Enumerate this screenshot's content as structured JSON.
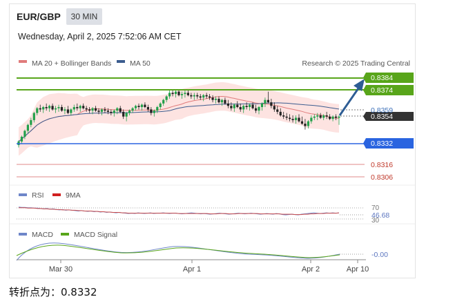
{
  "header": {
    "pair": "EUR/GBP",
    "timeframe": "30 MIN",
    "datetime": "Wednesday, April 2, 2025 7:52:06 AM CET"
  },
  "legend": {
    "ma20": "MA 20 + Bollinger Bands",
    "ma50": "MA 50",
    "research": "Research © 2025 Trading Central",
    "rsi": "RSI",
    "rsi_ma": "9MA",
    "macd": "MACD",
    "macd_signal": "MACD Signal"
  },
  "colors": {
    "resistance": "#58a51a",
    "pivot": "#2a64e0",
    "support": "#e08a8a",
    "support_text": "#c0392b",
    "current_box": "#333333",
    "ma20": "#e07b7b",
    "ma50": "#3b5c8f",
    "band": "#fde3e1",
    "candle_up": "#22a04a",
    "candle_down": "#222222",
    "arrow": "#2e5d94",
    "rsi": "#6e86c9",
    "rsi_ma": "#c94a4a",
    "macd": "#6e86c9",
    "macd_signal": "#58a51a"
  },
  "levels": {
    "resistance_2": "0.8384",
    "resistance_1": "0.8374",
    "ma50_label": "0.8359",
    "current": "0.8354",
    "pivot": "0.8332",
    "support_1": "0.8316",
    "support_2": "0.8306"
  },
  "rsi_panel": {
    "level_70": "70",
    "value": "46.68",
    "level_30": "30"
  },
  "macd_panel": {
    "value": "-0.00"
  },
  "footer": {
    "pivot_text": "转折点为：0.8332"
  },
  "chart_data": {
    "type": "candlestick",
    "x_ticks": [
      "Mar 30",
      "Apr 1",
      "Apr 2",
      "Apr 10"
    ],
    "price_ylim": [
      0.8298,
      0.8394
    ],
    "rsi_ylim": [
      20,
      80
    ],
    "candles": [
      [
        0.833,
        0.8334,
        0.8328,
        0.8333
      ],
      [
        0.8333,
        0.8338,
        0.8331,
        0.8337
      ],
      [
        0.8337,
        0.8343,
        0.8335,
        0.8342
      ],
      [
        0.8342,
        0.8348,
        0.834,
        0.8347
      ],
      [
        0.8347,
        0.8353,
        0.8345,
        0.8351
      ],
      [
        0.8351,
        0.8358,
        0.8349,
        0.8357
      ],
      [
        0.8357,
        0.8362,
        0.8355,
        0.8361
      ],
      [
        0.8361,
        0.8364,
        0.8358,
        0.836
      ],
      [
        0.836,
        0.8363,
        0.8357,
        0.8362
      ],
      [
        0.8362,
        0.8365,
        0.8359,
        0.8361
      ],
      [
        0.8361,
        0.8364,
        0.8358,
        0.8363
      ],
      [
        0.8363,
        0.8365,
        0.8359,
        0.836
      ],
      [
        0.836,
        0.8363,
        0.8357,
        0.8361
      ],
      [
        0.8361,
        0.8364,
        0.8358,
        0.8362
      ],
      [
        0.8362,
        0.8364,
        0.8358,
        0.8359
      ],
      [
        0.8359,
        0.8362,
        0.8356,
        0.836
      ],
      [
        0.836,
        0.8363,
        0.8356,
        0.8357
      ],
      [
        0.8357,
        0.8361,
        0.8355,
        0.836
      ],
      [
        0.836,
        0.8364,
        0.8358,
        0.8362
      ],
      [
        0.8362,
        0.8365,
        0.8359,
        0.8361
      ],
      [
        0.8361,
        0.8364,
        0.8358,
        0.8363
      ],
      [
        0.8363,
        0.8365,
        0.836,
        0.8361
      ],
      [
        0.8361,
        0.8363,
        0.8358,
        0.836
      ],
      [
        0.836,
        0.8362,
        0.8357,
        0.8359
      ],
      [
        0.8359,
        0.8362,
        0.8356,
        0.8361
      ],
      [
        0.8361,
        0.8363,
        0.8358,
        0.8359
      ],
      [
        0.8359,
        0.8361,
        0.8356,
        0.8358
      ],
      [
        0.8358,
        0.8361,
        0.8355,
        0.836
      ],
      [
        0.836,
        0.8362,
        0.8357,
        0.8359
      ],
      [
        0.8359,
        0.8361,
        0.8356,
        0.8358
      ],
      [
        0.8358,
        0.836,
        0.8355,
        0.8357
      ],
      [
        0.8357,
        0.836,
        0.8354,
        0.8359
      ],
      [
        0.8359,
        0.8362,
        0.8356,
        0.8361
      ],
      [
        0.8361,
        0.8363,
        0.8357,
        0.8358
      ],
      [
        0.8358,
        0.836,
        0.8352,
        0.8354
      ],
      [
        0.8354,
        0.8358,
        0.835,
        0.8357
      ],
      [
        0.8357,
        0.836,
        0.8355,
        0.8359
      ],
      [
        0.8359,
        0.8362,
        0.8357,
        0.8361
      ],
      [
        0.8361,
        0.8364,
        0.8359,
        0.8363
      ],
      [
        0.8363,
        0.8365,
        0.836,
        0.8362
      ],
      [
        0.8362,
        0.8365,
        0.8359,
        0.8364
      ],
      [
        0.8364,
        0.8366,
        0.8361,
        0.8362
      ],
      [
        0.8362,
        0.8364,
        0.8358,
        0.836
      ],
      [
        0.836,
        0.8362,
        0.8355,
        0.8357
      ],
      [
        0.8357,
        0.836,
        0.8354,
        0.8359
      ],
      [
        0.8359,
        0.8363,
        0.8357,
        0.8362
      ],
      [
        0.8362,
        0.8366,
        0.836,
        0.8365
      ],
      [
        0.8365,
        0.8369,
        0.8363,
        0.8368
      ],
      [
        0.8368,
        0.8372,
        0.8366,
        0.8371
      ],
      [
        0.8371,
        0.8376,
        0.8369,
        0.8374
      ],
      [
        0.8374,
        0.8377,
        0.8371,
        0.8373
      ],
      [
        0.8373,
        0.8376,
        0.837,
        0.8375
      ],
      [
        0.8375,
        0.8377,
        0.8371,
        0.8372
      ],
      [
        0.8372,
        0.8375,
        0.8369,
        0.8373
      ],
      [
        0.8373,
        0.8376,
        0.837,
        0.8374
      ],
      [
        0.8374,
        0.8376,
        0.8371,
        0.8372
      ],
      [
        0.8372,
        0.8374,
        0.8369,
        0.8371
      ],
      [
        0.8371,
        0.8374,
        0.8368,
        0.8372
      ],
      [
        0.8372,
        0.8374,
        0.8369,
        0.8371
      ],
      [
        0.8371,
        0.8373,
        0.8368,
        0.837
      ],
      [
        0.837,
        0.8373,
        0.8367,
        0.8372
      ],
      [
        0.8372,
        0.8374,
        0.8369,
        0.8371
      ],
      [
        0.8371,
        0.8373,
        0.8368,
        0.837
      ],
      [
        0.837,
        0.8372,
        0.8366,
        0.8368
      ],
      [
        0.8368,
        0.8371,
        0.8365,
        0.8369
      ],
      [
        0.8369,
        0.8371,
        0.8365,
        0.8366
      ],
      [
        0.8366,
        0.8369,
        0.8363,
        0.8368
      ],
      [
        0.8368,
        0.837,
        0.8364,
        0.8365
      ],
      [
        0.8365,
        0.8368,
        0.8361,
        0.8363
      ],
      [
        0.8363,
        0.8366,
        0.8359,
        0.8361
      ],
      [
        0.8361,
        0.8365,
        0.8358,
        0.8364
      ],
      [
        0.8364,
        0.8367,
        0.8361,
        0.8362
      ],
      [
        0.8362,
        0.8365,
        0.8358,
        0.836
      ],
      [
        0.836,
        0.8364,
        0.8357,
        0.8363
      ],
      [
        0.8363,
        0.8366,
        0.836,
        0.8362
      ],
      [
        0.8362,
        0.8365,
        0.8359,
        0.8364
      ],
      [
        0.8364,
        0.8366,
        0.836,
        0.8361
      ],
      [
        0.8361,
        0.8364,
        0.8357,
        0.8359
      ],
      [
        0.8359,
        0.8363,
        0.8356,
        0.8362
      ],
      [
        0.8362,
        0.8366,
        0.8359,
        0.8365
      ],
      [
        0.8365,
        0.837,
        0.8362,
        0.8368
      ],
      [
        0.8368,
        0.8375,
        0.8365,
        0.8366
      ],
      [
        0.8366,
        0.8369,
        0.8361,
        0.8363
      ],
      [
        0.8363,
        0.8366,
        0.8358,
        0.836
      ],
      [
        0.836,
        0.8363,
        0.8356,
        0.8358
      ],
      [
        0.8358,
        0.8361,
        0.8354,
        0.8355
      ],
      [
        0.8355,
        0.8358,
        0.8352,
        0.8354
      ],
      [
        0.8354,
        0.8357,
        0.8351,
        0.8353
      ],
      [
        0.8353,
        0.8356,
        0.835,
        0.8352
      ],
      [
        0.8352,
        0.8355,
        0.8349,
        0.8351
      ],
      [
        0.8351,
        0.8355,
        0.8348,
        0.8353
      ],
      [
        0.8353,
        0.8356,
        0.8349,
        0.835
      ],
      [
        0.835,
        0.8354,
        0.8347,
        0.8348
      ],
      [
        0.8348,
        0.8352,
        0.8343,
        0.8346
      ],
      [
        0.8346,
        0.8351,
        0.8344,
        0.835
      ],
      [
        0.835,
        0.8355,
        0.8348,
        0.8353
      ],
      [
        0.8353,
        0.8356,
        0.8351,
        0.8354
      ],
      [
        0.8354,
        0.8357,
        0.8351,
        0.8355
      ],
      [
        0.8355,
        0.8357,
        0.8352,
        0.8353
      ],
      [
        0.8353,
        0.8356,
        0.8351,
        0.8355
      ],
      [
        0.8355,
        0.8358,
        0.8352,
        0.8354
      ],
      [
        0.8354,
        0.8356,
        0.8351,
        0.8352
      ],
      [
        0.8352,
        0.8355,
        0.835,
        0.8354
      ],
      [
        0.8354,
        0.8356,
        0.8351,
        0.8353
      ],
      [
        0.8353,
        0.8355,
        0.8347,
        0.8354
      ]
    ],
    "rsi": [
      63,
      62,
      62,
      61,
      61,
      60,
      60,
      59,
      58,
      59,
      57,
      58,
      56,
      55,
      56,
      54,
      55,
      54,
      53,
      52,
      53,
      52,
      51,
      52,
      50,
      51,
      49,
      50,
      48,
      49,
      48,
      47,
      48,
      47,
      46,
      45,
      46,
      45,
      47,
      46,
      45,
      46,
      47,
      45,
      46,
      46,
      47,
      46,
      45,
      46,
      46,
      45,
      44,
      45,
      46,
      47,
      46,
      45,
      44,
      45,
      44,
      43,
      44,
      45,
      46,
      45,
      44,
      43,
      44,
      45,
      46,
      45,
      44,
      45,
      46,
      45,
      44,
      43,
      44,
      45,
      44,
      43,
      45,
      44,
      42,
      41,
      42,
      43,
      42,
      41,
      43,
      44,
      45,
      46,
      47,
      46,
      45,
      46,
      47,
      46,
      47,
      46,
      47
    ],
    "rsi_ma": [
      61,
      61,
      61,
      60,
      60,
      60,
      59,
      59,
      58,
      58,
      57,
      57,
      56,
      56,
      55,
      55,
      55,
      54,
      54,
      53,
      53,
      52,
      52,
      52,
      51,
      51,
      50,
      50,
      49,
      49,
      48,
      48,
      48,
      47,
      47,
      46,
      46,
      46,
      46,
      46,
      46,
      46,
      46,
      46,
      46,
      46,
      46,
      46,
      46,
      46,
      46,
      45,
      45,
      45,
      45,
      45,
      45,
      45,
      45,
      45,
      45,
      44,
      44,
      44,
      45,
      45,
      45,
      44,
      44,
      44,
      45,
      45,
      45,
      45,
      45,
      45,
      45,
      44,
      44,
      44,
      44,
      44,
      44,
      44,
      43,
      43,
      43,
      43,
      42,
      42,
      42,
      43,
      43,
      44,
      44,
      45,
      45,
      45,
      46,
      46,
      46,
      46,
      47
    ]
  }
}
